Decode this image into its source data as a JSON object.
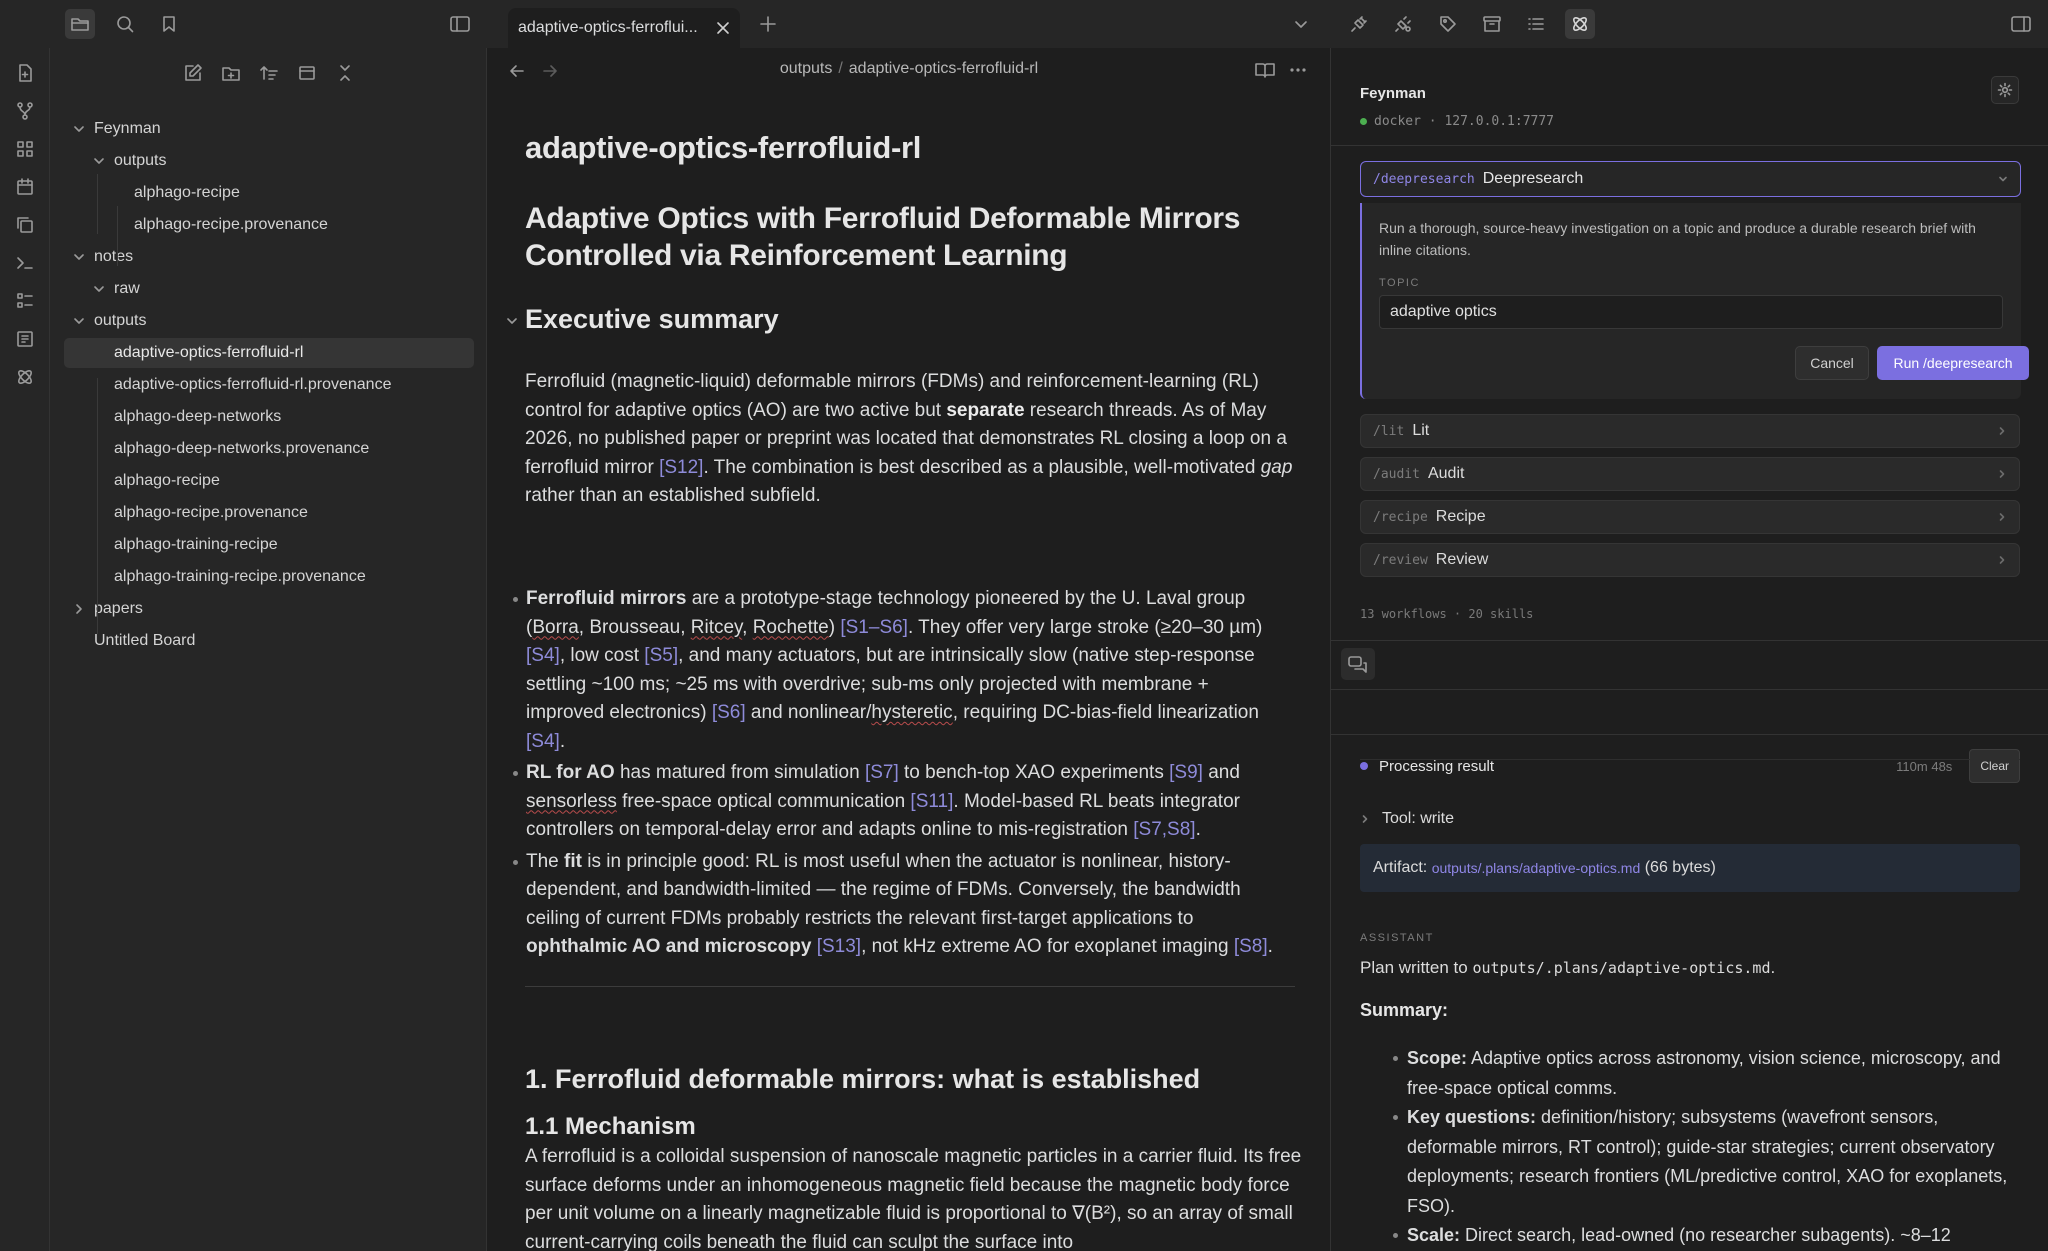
{
  "tab": {
    "title": "adaptive-optics-ferroflui..."
  },
  "icons": {
    "top_left": [
      "folder-icon",
      "search-icon",
      "bookmark-icon",
      "sidebar-toggle-icon"
    ],
    "top_right": [
      "plugin-icon",
      "plugin-sync-icon",
      "tag-icon",
      "archive-icon",
      "list-icon",
      "atom-icon",
      "right-sidebar-toggle-icon"
    ],
    "ribbon": [
      "file-plus-icon",
      "git-icon",
      "grid-icon",
      "calendar-icon",
      "copy-icon",
      "terminal-icon",
      "list-grid-icon",
      "book-icon",
      "atom-icon"
    ]
  },
  "file_tree": {
    "items": [
      {
        "label": "Feynman",
        "depth": 0,
        "chevron": "down"
      },
      {
        "label": "outputs",
        "depth": 1,
        "chevron": "down"
      },
      {
        "label": "alphago-recipe",
        "depth": 2
      },
      {
        "label": "alphago-recipe.provenance",
        "depth": 2
      },
      {
        "label": "notes",
        "depth": 0,
        "chevron": "down"
      },
      {
        "label": "raw",
        "depth": 1,
        "chevron": "down"
      },
      {
        "label": "outputs",
        "depth": 0,
        "chevron": "down"
      },
      {
        "label": "adaptive-optics-ferrofluid-rl",
        "depth": 1,
        "selected": true
      },
      {
        "label": "adaptive-optics-ferrofluid-rl.provenance",
        "depth": 1
      },
      {
        "label": "alphago-deep-networks",
        "depth": 1
      },
      {
        "label": "alphago-deep-networks.provenance",
        "depth": 1
      },
      {
        "label": "alphago-recipe",
        "depth": 1
      },
      {
        "label": "alphago-recipe.provenance",
        "depth": 1
      },
      {
        "label": "alphago-training-recipe",
        "depth": 1
      },
      {
        "label": "alphago-training-recipe.provenance",
        "depth": 1
      },
      {
        "label": "papers",
        "depth": 0,
        "chevron": "right"
      },
      {
        "label": "Untitled Board",
        "depth": 0
      }
    ]
  },
  "breadcrumb": {
    "folder": "outputs",
    "separator": "/",
    "file": "adaptive-optics-ferrofluid-rl"
  },
  "doc": {
    "inline_title": "adaptive-optics-ferrofluid-rl",
    "title": "Adaptive Optics with Ferrofluid Deformable Mirrors Controlled via Reinforcement Learning",
    "exec_heading": "Executive summary",
    "exec_para": [
      "Ferrofluid (magnetic-liquid) deformable mirrors (FDMs) and reinforcement-learning (RL) control for adaptive optics (AO) are two active but ",
      "separate",
      " research threads. As of May 2026, no published paper or preprint was located that demonstrates RL closing a loop on a ferrofluid mirror ",
      "[S12]",
      ". The combination is best described as a plausible, well-motivated ",
      "gap",
      " rather than an established subfield."
    ],
    "bullet1": [
      "Ferrofluid mirrors",
      " are a prototype-stage technology pioneered by the U. Laval group (",
      "Borra",
      ", Brousseau, ",
      "Ritcey",
      ", ",
      "Rochette",
      ") ",
      "[S1–S6]",
      ". They offer very large stroke (≥20–30 µm) ",
      "[S4]",
      ", low cost ",
      "[S5]",
      ", and many actuators, but are intrinsically slow (native step-response settling ~100 ms; ~25 ms with overdrive; sub-ms only projected with membrane + improved electronics) ",
      "[S6]",
      " and nonlinear/",
      "hysteretic",
      ", requiring DC-bias-field linearization ",
      "[S4]",
      "."
    ],
    "bullet2": [
      "RL for AO",
      " has matured from simulation ",
      "[S7]",
      " to bench-top XAO experiments ",
      "[S9]",
      " and ",
      "sensorless",
      " free-space optical communication ",
      "[S11]",
      ". Model-based RL beats integrator controllers on temporal-delay error and adapts online to mis-registration ",
      "[S7,S8]",
      "."
    ],
    "bullet3": [
      "The ",
      "fit",
      " is in principle good: RL is most useful when the actuator is nonlinear, history-dependent, and bandwidth-limited — the regime of FDMs. Conversely, the bandwidth ceiling of current FDMs probably restricts the relevant first-target applications to ",
      "ophthalmic AO and microscopy",
      " ",
      "[S13]",
      ", not kHz extreme AO for exoplanet imaging ",
      "[S8]",
      "."
    ],
    "section1": "1. Ferrofluid deformable mirrors: what is established",
    "section11": "1.1 Mechanism",
    "mechanism": "A ferrofluid is a colloidal suspension of nanoscale magnetic particles in a carrier fluid. Its free surface deforms under an inhomogeneous magnetic field because the magnetic body force per unit volume on a linearly magnetizable fluid is proportional to ∇(B²), so an array of small current-carrying coils beneath the fluid can sculpt the surface into"
  },
  "assistant_panel": {
    "name": "Feynman",
    "status_dot_color": "#4caf50",
    "status": "docker · 127.0.0.1:7777",
    "workflow_expanded": {
      "cmd": "/deepresearch",
      "label": "Deepresearch",
      "description": "Run a thorough, source-heavy investigation on a topic and produce a durable research brief with inline citations.",
      "topic_label": "TOPIC",
      "topic_value": "adaptive optics",
      "cancel": "Cancel",
      "run": "Run /deepresearch"
    },
    "workflows": [
      {
        "cmd": "/lit",
        "label": "Lit"
      },
      {
        "cmd": "/audit",
        "label": "Audit"
      },
      {
        "cmd": "/recipe",
        "label": "Recipe"
      },
      {
        "cmd": "/review",
        "label": "Review"
      }
    ],
    "counts": "13 workflows · 20 skills",
    "processing": {
      "label": "Processing result",
      "elapsed": "110m 48s",
      "clear": "Clear",
      "dot_color": "#7b6fe0"
    },
    "tool": "Tool: write",
    "artifact": {
      "prefix": "Artifact: ",
      "path": "outputs/.plans/adaptive-optics.md",
      "size": "(66 bytes)"
    },
    "assistant_label": "ASSISTANT",
    "plan_prefix": "Plan written to ",
    "plan_path": "outputs/.plans/adaptive-optics.md",
    "plan_suffix": ".",
    "summary_heading": "Summary:",
    "summary": [
      {
        "bold": "Scope:",
        "text": " Adaptive optics across astronomy, vision science, microscopy, and free-space optical comms."
      },
      {
        "bold": "Key questions:",
        "text": " definition/history; subsystems (wavefront sensors, deformable mirrors, RT control); guide-star strategies; current observatory deployments; research frontiers (ML/predictive control, XAO for exoplanets, FSO)."
      },
      {
        "bold": "Scale:",
        "text": " Direct search, lead-owned (no researcher subagents). ~8–12"
      }
    ]
  },
  "colors": {
    "accent": "#7b6fe0",
    "citation": "#8e8bd9",
    "selected_bg": "#353535"
  }
}
